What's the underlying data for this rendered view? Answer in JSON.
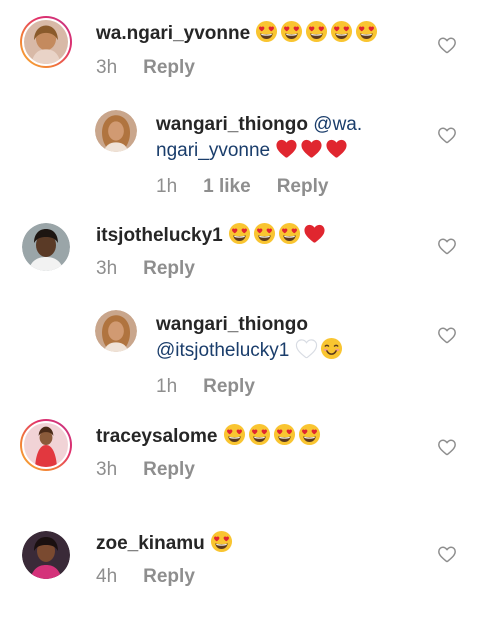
{
  "comments": [
    {
      "username": "wa.ngari_yvonne",
      "text_after": "",
      "time": "3h",
      "reply_label": "Reply"
    },
    {
      "username": "wangari_thiongo",
      "mention_line1": "@wa.",
      "mention_line2": "ngari_yvonne",
      "time": "1h",
      "likes": "1 like",
      "reply_label": "Reply"
    },
    {
      "username": "itsjothelucky1",
      "time": "3h",
      "reply_label": "Reply"
    },
    {
      "username": "wangari_thiongo",
      "mention": "@itsjothelucky1",
      "time": "1h",
      "reply_label": "Reply"
    },
    {
      "username": "traceysalome",
      "time": "3h",
      "reply_label": "Reply"
    },
    {
      "username": "zoe_kinamu",
      "time": "4h",
      "reply_label": "Reply"
    }
  ],
  "icons": {
    "like": "heart-outline-icon",
    "heart_eyes": "heart-eyes-emoji",
    "red_heart": "red-heart-emoji",
    "white_heart": "white-heart-emoji",
    "smiling": "smiling-face-emoji"
  },
  "colors": {
    "username": "#262626",
    "meta": "#8e8e8e",
    "mention": "#1a3d6b",
    "heart_red": "#e0262f",
    "emoji_yellow": "#f9c531"
  }
}
